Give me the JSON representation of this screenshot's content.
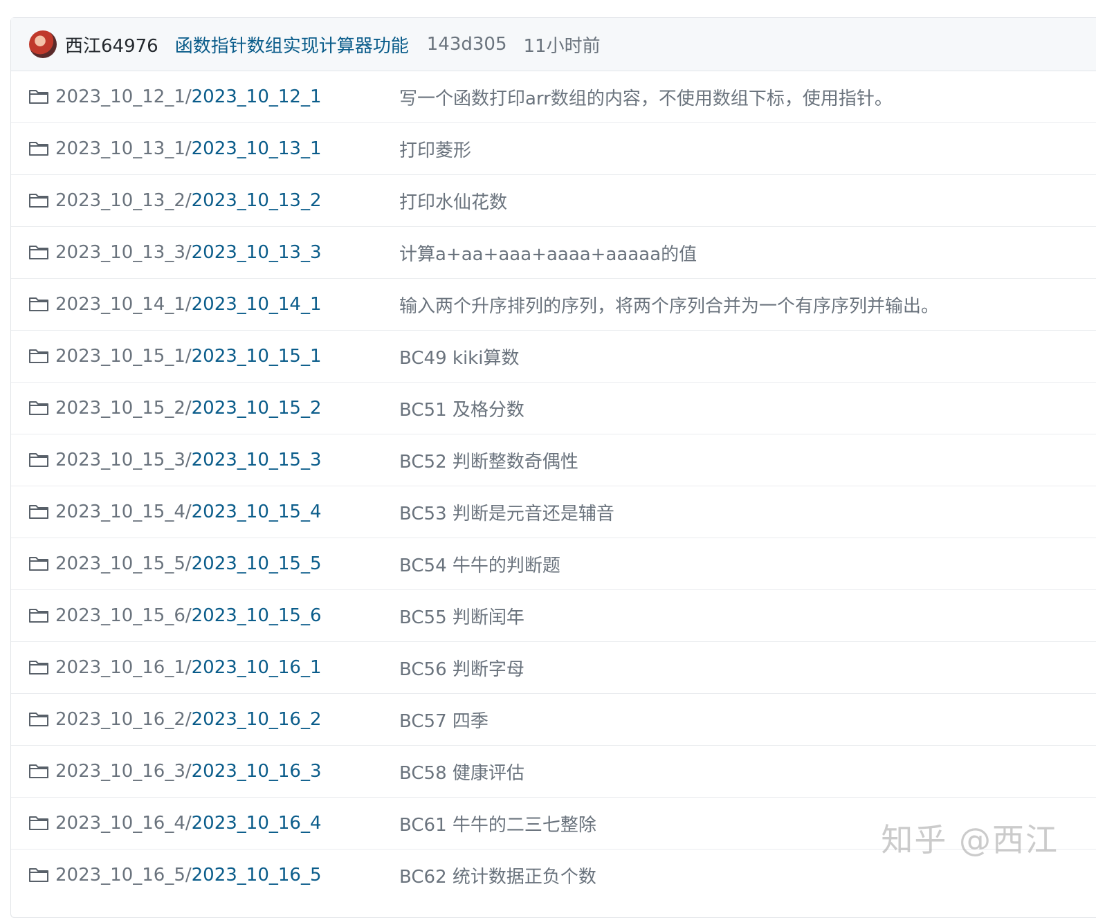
{
  "commit": {
    "author": "西江64976",
    "message": "函数指针数组实现计算器功能",
    "sha": "143d305",
    "time": "11小时前"
  },
  "files": [
    {
      "prefix": "2023_10_12_1/",
      "name": "2023_10_12_1",
      "message": "写一个函数打印arr数组的内容，不使用数组下标，使用指针。"
    },
    {
      "prefix": "2023_10_13_1/",
      "name": "2023_10_13_1",
      "message": "打印菱形"
    },
    {
      "prefix": "2023_10_13_2/",
      "name": "2023_10_13_2",
      "message": "打印水仙花数"
    },
    {
      "prefix": "2023_10_13_3/",
      "name": "2023_10_13_3",
      "message": "计算a+aa+aaa+aaaa+aaaaa的值"
    },
    {
      "prefix": "2023_10_14_1/",
      "name": "2023_10_14_1",
      "message": "输入两个升序排列的序列，将两个序列合并为一个有序序列并输出。"
    },
    {
      "prefix": "2023_10_15_1/",
      "name": "2023_10_15_1",
      "message": "BC49 kiki算数"
    },
    {
      "prefix": "2023_10_15_2/",
      "name": "2023_10_15_2",
      "message": "BC51 及格分数"
    },
    {
      "prefix": "2023_10_15_3/",
      "name": "2023_10_15_3",
      "message": "BC52 判断整数奇偶性"
    },
    {
      "prefix": "2023_10_15_4/",
      "name": "2023_10_15_4",
      "message": "BC53 判断是元音还是辅音"
    },
    {
      "prefix": "2023_10_15_5/",
      "name": "2023_10_15_5",
      "message": "BC54 牛牛的判断题"
    },
    {
      "prefix": "2023_10_15_6/",
      "name": "2023_10_15_6",
      "message": "BC55 判断闰年"
    },
    {
      "prefix": "2023_10_16_1/",
      "name": "2023_10_16_1",
      "message": "BC56 判断字母"
    },
    {
      "prefix": "2023_10_16_2/",
      "name": "2023_10_16_2",
      "message": "BC57 四季"
    },
    {
      "prefix": "2023_10_16_3/",
      "name": "2023_10_16_3",
      "message": "BC58 健康评估"
    },
    {
      "prefix": "2023_10_16_4/",
      "name": "2023_10_16_4",
      "message": "BC61 牛牛的二三七整除"
    },
    {
      "prefix": "2023_10_16_5/",
      "name": "2023_10_16_5",
      "message": "BC62 统计数据正负个数"
    }
  ],
  "watermark": "知乎 @西江",
  "icons": {
    "folder": "folder-icon",
    "avatar": "avatar"
  },
  "colors": {
    "link": "#0a5c8a",
    "muted": "#6a737d",
    "header_bg": "#f6f8fa"
  }
}
